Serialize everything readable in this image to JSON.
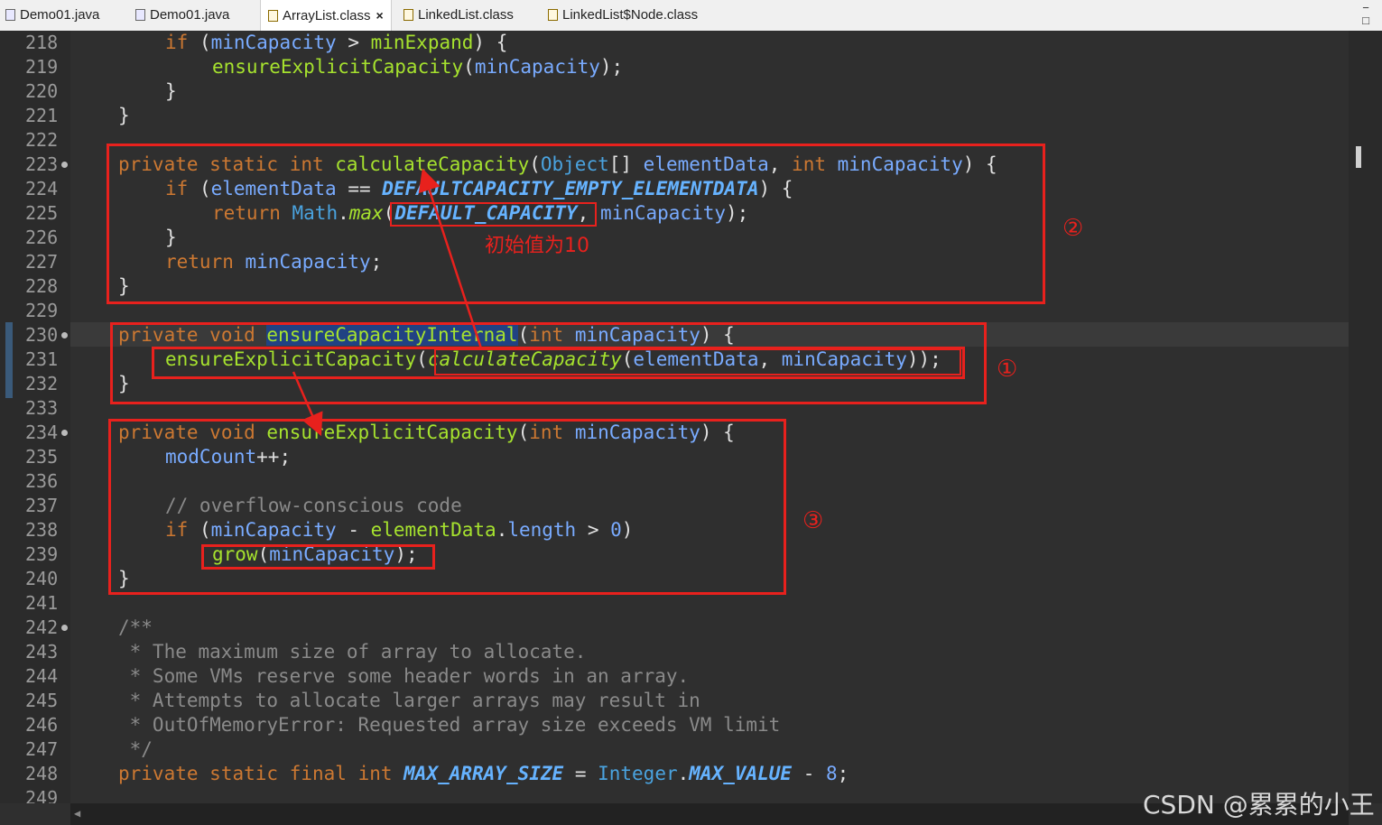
{
  "tabs": [
    {
      "label": "Demo01.java",
      "active": false,
      "icon": "java-file-icon"
    },
    {
      "label": "Demo01.java",
      "active": false,
      "icon": "java-file-icon"
    },
    {
      "label": "ArrayList.class",
      "active": true,
      "icon": "class-file-icon"
    },
    {
      "label": "LinkedList.class",
      "active": false,
      "icon": "class-file-icon"
    },
    {
      "label": "LinkedList$Node.class",
      "active": false,
      "icon": "class-file-icon"
    }
  ],
  "tab_close_glyph": "×",
  "line_numbers": [
    "218",
    "219",
    "220",
    "221",
    "222",
    "223",
    "224",
    "225",
    "226",
    "227",
    "228",
    "229",
    "230",
    "231",
    "232",
    "233",
    "234",
    "235",
    "236",
    "237",
    "238",
    "239",
    "240",
    "241",
    "242",
    "243",
    "244",
    "245",
    "246",
    "247",
    "248",
    "249"
  ],
  "code": {
    "l218": {
      "kw": "if",
      "open": " (",
      "a": "minCapacity",
      "op": " > ",
      "b": "minExpand",
      "close": ") {"
    },
    "l219": {
      "fn": "ensureExplicitCapacity",
      "open": "(",
      "arg": "minCapacity",
      "close": ");"
    },
    "l220": "}",
    "l221": "}",
    "l223": {
      "kw1": "private",
      "kw2": "static",
      "kw3": "int",
      "fn": "calculateCapacity",
      "open": "(",
      "type": "Object",
      "arr": "[] ",
      "p1": "elementData",
      "comma": ", ",
      "kw4": "int",
      "p2": "minCapacity",
      "close": ") {"
    },
    "l224": {
      "kw": "if",
      "open": " (",
      "a": "elementData",
      "op": " == ",
      "c": "DEFAULTCAPACITY_EMPTY_ELEMENTDATA",
      "close": ") {"
    },
    "l225": {
      "kw": "return",
      "cls": "Math",
      "dot": ".",
      "m": "max",
      "open": "(",
      "c": "DEFAULT_CAPACITY",
      "comma": ", ",
      "b": "minCapacity",
      "close": ");"
    },
    "l226": "}",
    "l227": {
      "kw": "return",
      "v": "minCapacity",
      "semi": ";"
    },
    "l228": "}",
    "l230": {
      "kw1": "private",
      "kw2": "void",
      "fn": "ensureCapacityInternal",
      "open": "(",
      "kw3": "int",
      "p": "minCapacity",
      "close": ") {"
    },
    "l231": {
      "fn": "ensureExplicitCapacity",
      "open": "(",
      "inner": "calculateCapacity",
      "open2": "(",
      "a": "elementData",
      "comma": ", ",
      "b": "minCapacity",
      "close": "));"
    },
    "l232": "}",
    "l234": {
      "kw1": "private",
      "kw2": "void",
      "fn": "ensureExplicitCapacity",
      "open": "(",
      "kw3": "int",
      "p": "minCapacity",
      "close": ") {"
    },
    "l235": {
      "v": "modCount",
      "rest": "++;"
    },
    "l237": "// overflow-conscious code",
    "l238": {
      "kw": "if",
      "open": " (",
      "a": "minCapacity",
      "op": " - ",
      "b": "elementData",
      "dot": ".",
      "c": "length",
      "op2": " > ",
      "n": "0",
      "close": ")"
    },
    "l239": {
      "fn": "grow",
      "open": "(",
      "arg": "minCapacity",
      "close": ");"
    },
    "l240": "}",
    "l242": "/**",
    "l243": " * The maximum size of array to allocate.",
    "l244": " * Some VMs reserve some header words in an array.",
    "l245": " * Attempts to allocate larger arrays may result in",
    "l246": " * OutOfMemoryError: Requested array size exceeds VM limit",
    "l247": " */",
    "l248": {
      "kw1": "private",
      "kw2": "static",
      "kw3": "final",
      "kw4": "int",
      "c": "MAX_ARRAY_SIZE",
      "eq": " = ",
      "cls": "Integer",
      "dot": ".",
      "c2": "MAX_VALUE",
      "op": " - ",
      "n": "8",
      "semi": ";"
    }
  },
  "annotations": {
    "mark1": "①",
    "mark2": "②",
    "mark3": "③",
    "note": "初始值为10",
    "color": "#e8211d"
  },
  "window_controls": {
    "minimize": "−",
    "maximize": "□"
  },
  "watermark": "CSDN @累累的小王"
}
